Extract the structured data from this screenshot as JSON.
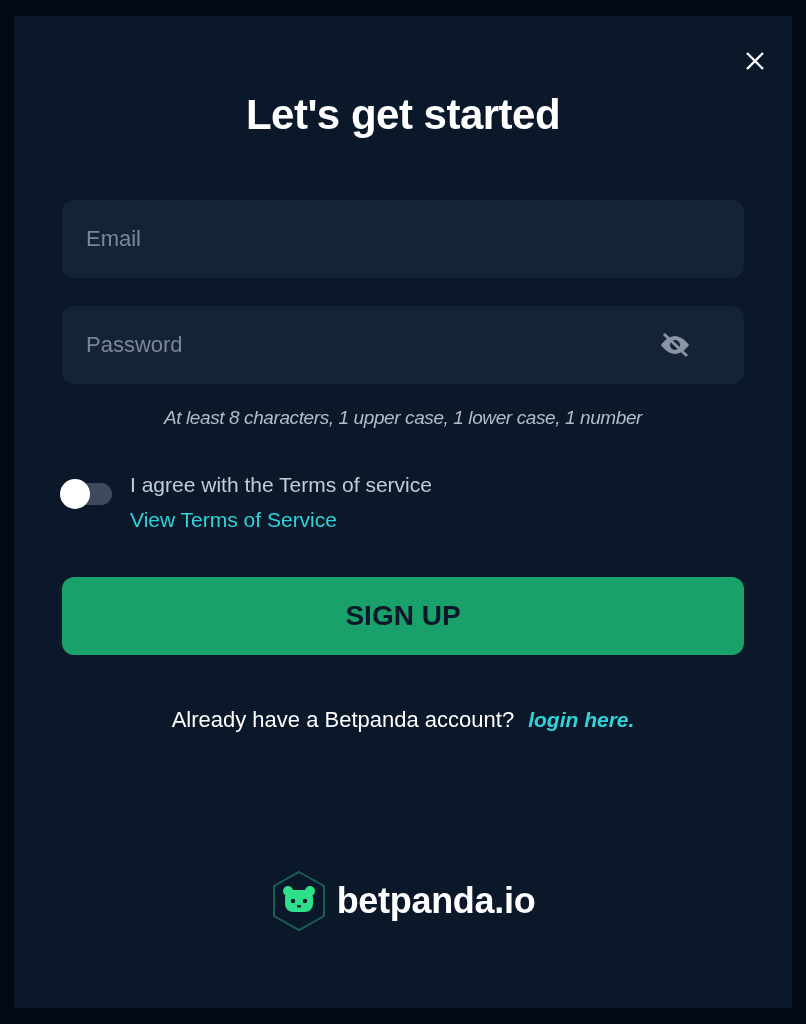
{
  "title": "Let's get started",
  "email": {
    "placeholder": "Email"
  },
  "password": {
    "placeholder": "Password"
  },
  "hint": "At least 8 characters, 1 upper case, 1 lower case, 1 number",
  "terms": {
    "on": false,
    "text": "I agree with the Terms of service",
    "link": "View Terms of Service"
  },
  "submit": "SIGN UP",
  "login_prompt": {
    "text": "Already have a Betpanda account?",
    "link": "login here."
  },
  "brand": "betpanda.io"
}
